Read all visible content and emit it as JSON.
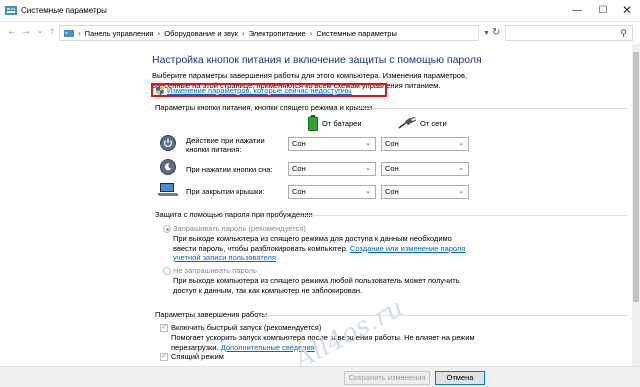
{
  "window": {
    "title": "Системные параметры"
  },
  "address": {
    "crumbs": [
      "Панель управления",
      "Оборудование и звук",
      "Электропитание",
      "Системные параметры"
    ]
  },
  "main": {
    "heading": "Настройка кнопок питания и включение защиты с помощью пароля",
    "description": "Выберите параметры завершения работы для этого компьютера. Изменения параметров, внесенные на этой странице, применяются ко всем схемам управления питанием.",
    "change_link": "Изменение параметров, которые сейчас недоступны"
  },
  "power_buttons": {
    "section_title": "Параметры кнопки питания, кнопки спящего режима и крышки",
    "battery_label": "От батареи",
    "ac_label": "От сети",
    "rows": [
      {
        "label": "Действие при нажатии кнопки питания:",
        "battery": "Сон",
        "ac": "Сон",
        "icon": "power-button-icon"
      },
      {
        "label": "При нажатии кнопки сна:",
        "battery": "Сон",
        "ac": "Сон",
        "icon": "sleep-button-icon"
      },
      {
        "label": "При закрытии крышки:",
        "battery": "Сон",
        "ac": "Сон",
        "icon": "laptop-lid-icon"
      }
    ]
  },
  "password": {
    "section_title": "Защита с помощью пароля при пробуждении",
    "require_label": "Запрашивать пароль (рекомендуется)",
    "require_desc": "При выходе компьютера из спящего режима для доступа к данным необходимо ввести пароль, чтобы разблокировать компьютер.",
    "require_link": "Создание или изменение пароля учетной записи пользователя",
    "norequire_label": "Не запрашивать пароль",
    "norequire_desc": "При выходе компьютера из спящего режима любой пользователь может получить доступ к данным, так как компьютер не заблокирован."
  },
  "shutdown": {
    "section_title": "Параметры завершения работы",
    "fast_startup_label": "Включить быстрый запуск (рекомендуется)",
    "fast_startup_desc": "Помогает ускорить запуск компьютера после завершения работы. Не влияет на режим перезагрузки.",
    "fast_startup_link": "Дополнительные сведения",
    "sleep_label": "Спящий режим"
  },
  "footer": {
    "save_label": "Сохранить изменения",
    "cancel_label": "Отмена"
  },
  "watermark": "All4os.ru",
  "colors": {
    "heading": "#1e3287",
    "link": "#0066cc",
    "highlight": "#e0181b"
  }
}
